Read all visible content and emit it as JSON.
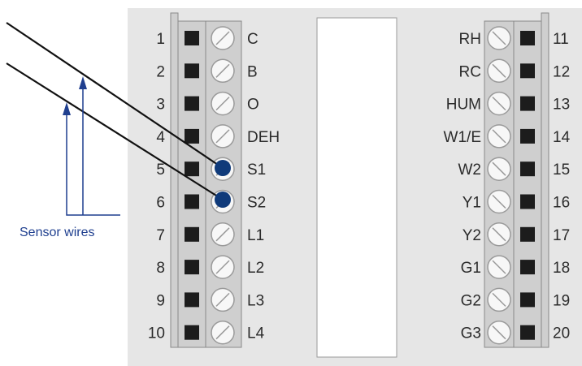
{
  "left_terminals": [
    {
      "number": "1",
      "label": "C"
    },
    {
      "number": "2",
      "label": "B"
    },
    {
      "number": "3",
      "label": "O"
    },
    {
      "number": "4",
      "label": "DEH"
    },
    {
      "number": "5",
      "label": "S1",
      "wired": true
    },
    {
      "number": "6",
      "label": "S2",
      "wired": true
    },
    {
      "number": "7",
      "label": "L1"
    },
    {
      "number": "8",
      "label": "L2"
    },
    {
      "number": "9",
      "label": "L3"
    },
    {
      "number": "10",
      "label": "L4"
    }
  ],
  "right_terminals": [
    {
      "number": "11",
      "label": "RH"
    },
    {
      "number": "12",
      "label": "RC"
    },
    {
      "number": "13",
      "label": "HUM"
    },
    {
      "number": "14",
      "label": "W1/E"
    },
    {
      "number": "15",
      "label": "W2"
    },
    {
      "number": "16",
      "label": "Y1"
    },
    {
      "number": "17",
      "label": "Y2"
    },
    {
      "number": "18",
      "label": "G1"
    },
    {
      "number": "19",
      "label": "G2"
    },
    {
      "number": "20",
      "label": "G3"
    }
  ],
  "callout": {
    "text": "Sensor wires"
  },
  "colors": {
    "panel": "#e6e6e6",
    "strip": "#cfcfcf",
    "terminal_square": "#1c1c1c",
    "wire": "#111111",
    "wire_dot": "#0f3a7a",
    "callout": "#1f3f8f"
  }
}
